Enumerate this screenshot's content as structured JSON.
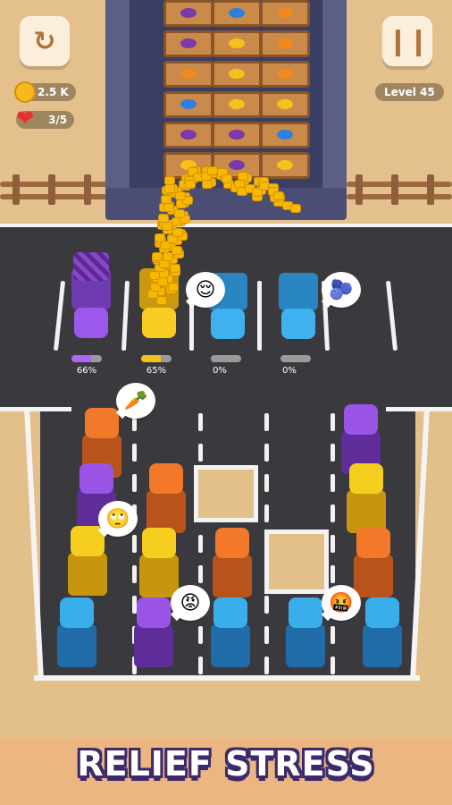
{
  "hud": {
    "coins": "2.5 K",
    "lives": "3/5",
    "level": "Level 45",
    "restart_icon": "restart-icon",
    "pause_icon": "pause-icon"
  },
  "parked_trucks": [
    {
      "color": "#8f4fe0",
      "progress": 0.66,
      "label": "66%",
      "fill": "#b066f0"
    },
    {
      "color": "#f2c21a",
      "progress": 0.65,
      "label": "65%",
      "fill": "#f2c21a"
    },
    {
      "color": "#35a9e8",
      "progress": 0.0,
      "label": "0%",
      "fill": "#35a9e8"
    },
    {
      "color": "#35a9e8",
      "progress": 0.0,
      "label": "0%",
      "fill": "#35a9e8"
    }
  ],
  "bubbles": {
    "smile": "😌",
    "blueberry": "🫐",
    "carrot": "🥕",
    "eyeroll": "🙄",
    "angry": "😡",
    "swear": "🤬"
  },
  "banner": {
    "text": "RELIEF STRESS"
  }
}
